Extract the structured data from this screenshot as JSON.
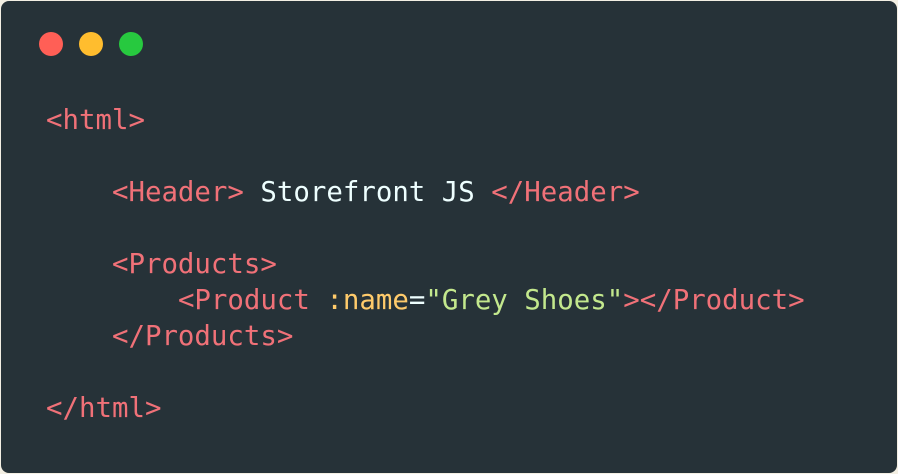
{
  "window": {
    "controls": [
      {
        "name": "close",
        "color": "#ff5f56"
      },
      {
        "name": "minimize",
        "color": "#ffbd2e"
      },
      {
        "name": "maximize",
        "color": "#27c93f"
      }
    ]
  },
  "code": {
    "html_open": "<html>",
    "header_open": "<Header>",
    "header_text": " Storefront JS ",
    "header_close": "</Header>",
    "products_open": "<Products>",
    "product_open": "<Product",
    "attr_prefix": ":",
    "attr_name": "name",
    "equals": "=",
    "attr_value": "\"Grey Shoes\"",
    "product_end": "></Product>",
    "products_close": "</Products>",
    "html_close": "</html>"
  },
  "colors": {
    "background": "#263238",
    "tag": "#f07178",
    "text": "#eeffff",
    "attribute": "#ffcb6b",
    "string": "#c3e88d"
  }
}
